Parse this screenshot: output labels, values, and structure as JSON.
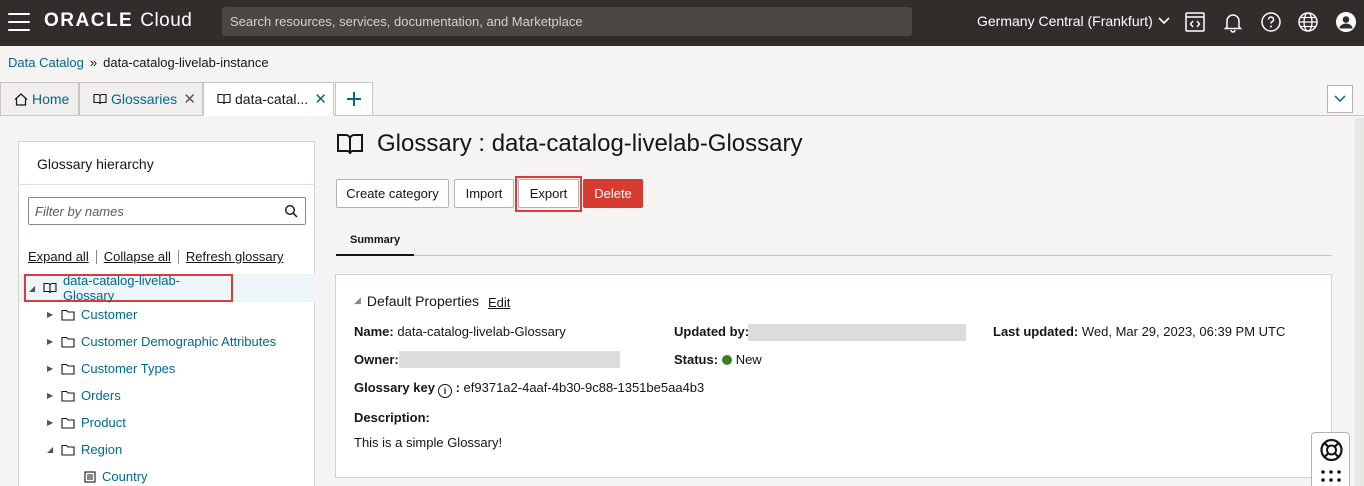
{
  "header": {
    "logo_brand": "ORACLE",
    "logo_product": "Cloud",
    "search_placeholder": "Search resources, services, documentation, and Marketplace",
    "region": "Germany Central (Frankfurt)"
  },
  "breadcrumb": {
    "root": "Data Catalog",
    "separator": "»",
    "current": "data-catalog-livelab-instance"
  },
  "tabs": [
    {
      "label": "Home"
    },
    {
      "label": "Glossaries"
    },
    {
      "label": "data-catal..."
    }
  ],
  "sidebar": {
    "title": "Glossary hierarchy",
    "filter_placeholder": "Filter by names",
    "expand_all": "Expand all",
    "collapse_all": "Collapse all",
    "refresh": "Refresh glossary",
    "root": "data-catalog-livelab-Glossary",
    "items": [
      {
        "label": "Customer"
      },
      {
        "label": "Customer Demographic Attributes"
      },
      {
        "label": "Customer Types"
      },
      {
        "label": "Orders"
      },
      {
        "label": "Product"
      },
      {
        "label": "Region"
      },
      {
        "label": "Country"
      }
    ]
  },
  "main": {
    "title": "Glossary : data-catalog-livelab-Glossary",
    "buttons": {
      "create_category": "Create category",
      "import": "Import",
      "export": "Export",
      "delete": "Delete"
    },
    "subtab": "Summary",
    "section_title": "Default Properties",
    "edit": "Edit",
    "name_label": "Name:",
    "name_value": "data-catalog-livelab-Glossary",
    "updated_by_label": "Updated by:",
    "last_updated_label": "Last updated:",
    "last_updated_value": "Wed, Mar 29, 2023, 06:39 PM UTC",
    "owner_label": "Owner:",
    "status_label": "Status:",
    "status_value": "New",
    "key_label": "Glossary key",
    "key_value": "ef9371a2-4aaf-4b30-9c88-1351be5aa4b3",
    "description_label": "Description:",
    "description_value": "This is a simple Glossary!"
  },
  "colors": {
    "topbar": "#312d2a",
    "link": "#00688c",
    "delete": "#d73b2f",
    "highlight": "#d93a3f",
    "status_new": "#3f7e23"
  }
}
